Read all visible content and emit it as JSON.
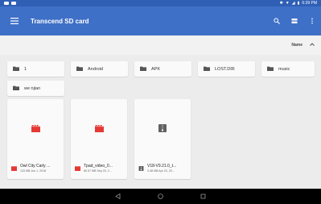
{
  "status_bar": {
    "time": "6:39 PM",
    "icons": [
      "notification-icon",
      "notification-icon",
      "bluetooth-icon",
      "wifi-icon",
      "signal-icon",
      "battery-icon"
    ]
  },
  "app_bar": {
    "title": "Transcend SD card",
    "icons": [
      "menu-icon",
      "search-icon",
      "list-view-icon",
      "more-vert-icon"
    ]
  },
  "sort": {
    "label": "Name",
    "icon": "arrow-up-icon"
  },
  "folders": [
    {
      "label": "1"
    },
    {
      "label": "Android"
    },
    {
      "label": "APK"
    },
    {
      "label": "LOST.DIR"
    },
    {
      "label": "music"
    },
    {
      "label": "we njian"
    }
  ],
  "files": [
    {
      "name": "Owl City Carly ...",
      "meta": "133 MB Jun 1, 2018",
      "type": "video",
      "color": "#e53935"
    },
    {
      "name": "Tpad_video_0...",
      "meta": "80.57 MB Sep 20, 2...",
      "type": "video",
      "color": "#e53935"
    },
    {
      "name": "V18-V9.21.0_t...",
      "meta": "3.48 MB Apr 23, 20...",
      "type": "archive",
      "color": "#616161"
    }
  ],
  "colors": {
    "status_bar": "#2f5fb5",
    "app_bar": "#3f70c7",
    "background": "#ececec",
    "video_icon": "#e53935"
  }
}
